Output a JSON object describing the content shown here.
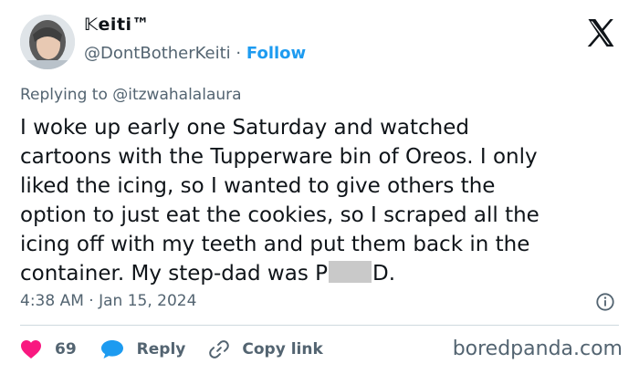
{
  "author": {
    "display_name": "𝕂eiti™",
    "handle": "@DontBotherKeiti",
    "separator": "·",
    "follow_label": "Follow"
  },
  "tweet": {
    "reply_prefix": "Replying to",
    "reply_mention": "@itzwahalalaura",
    "lines": [
      "I woke up early one Saturday and watched",
      "cartoons with the Tupperware bin of Oreos. I only",
      "liked the icing, so I wanted to give others the",
      "option to just eat the cookies, so I scraped all the",
      "icing off with my teeth and put them back in the"
    ],
    "last_line_before": "container. My step-dad was P",
    "last_line_after": "D.",
    "time": "4:38 AM",
    "date_separator": "·",
    "date": "Jan 15, 2024"
  },
  "actions": {
    "like_count": "69",
    "reply_label": "Reply",
    "copy_link_label": "Copy link"
  },
  "watermark": "boredpanda.com",
  "colors": {
    "accent": "#1d9bf0",
    "like": "#f91880",
    "muted": "#536471",
    "text": "#0f1419"
  },
  "icons": {
    "platform": "x-logo-icon",
    "info": "info-icon",
    "like": "heart-icon",
    "reply": "speech-bubble-icon",
    "copy": "link-icon"
  }
}
